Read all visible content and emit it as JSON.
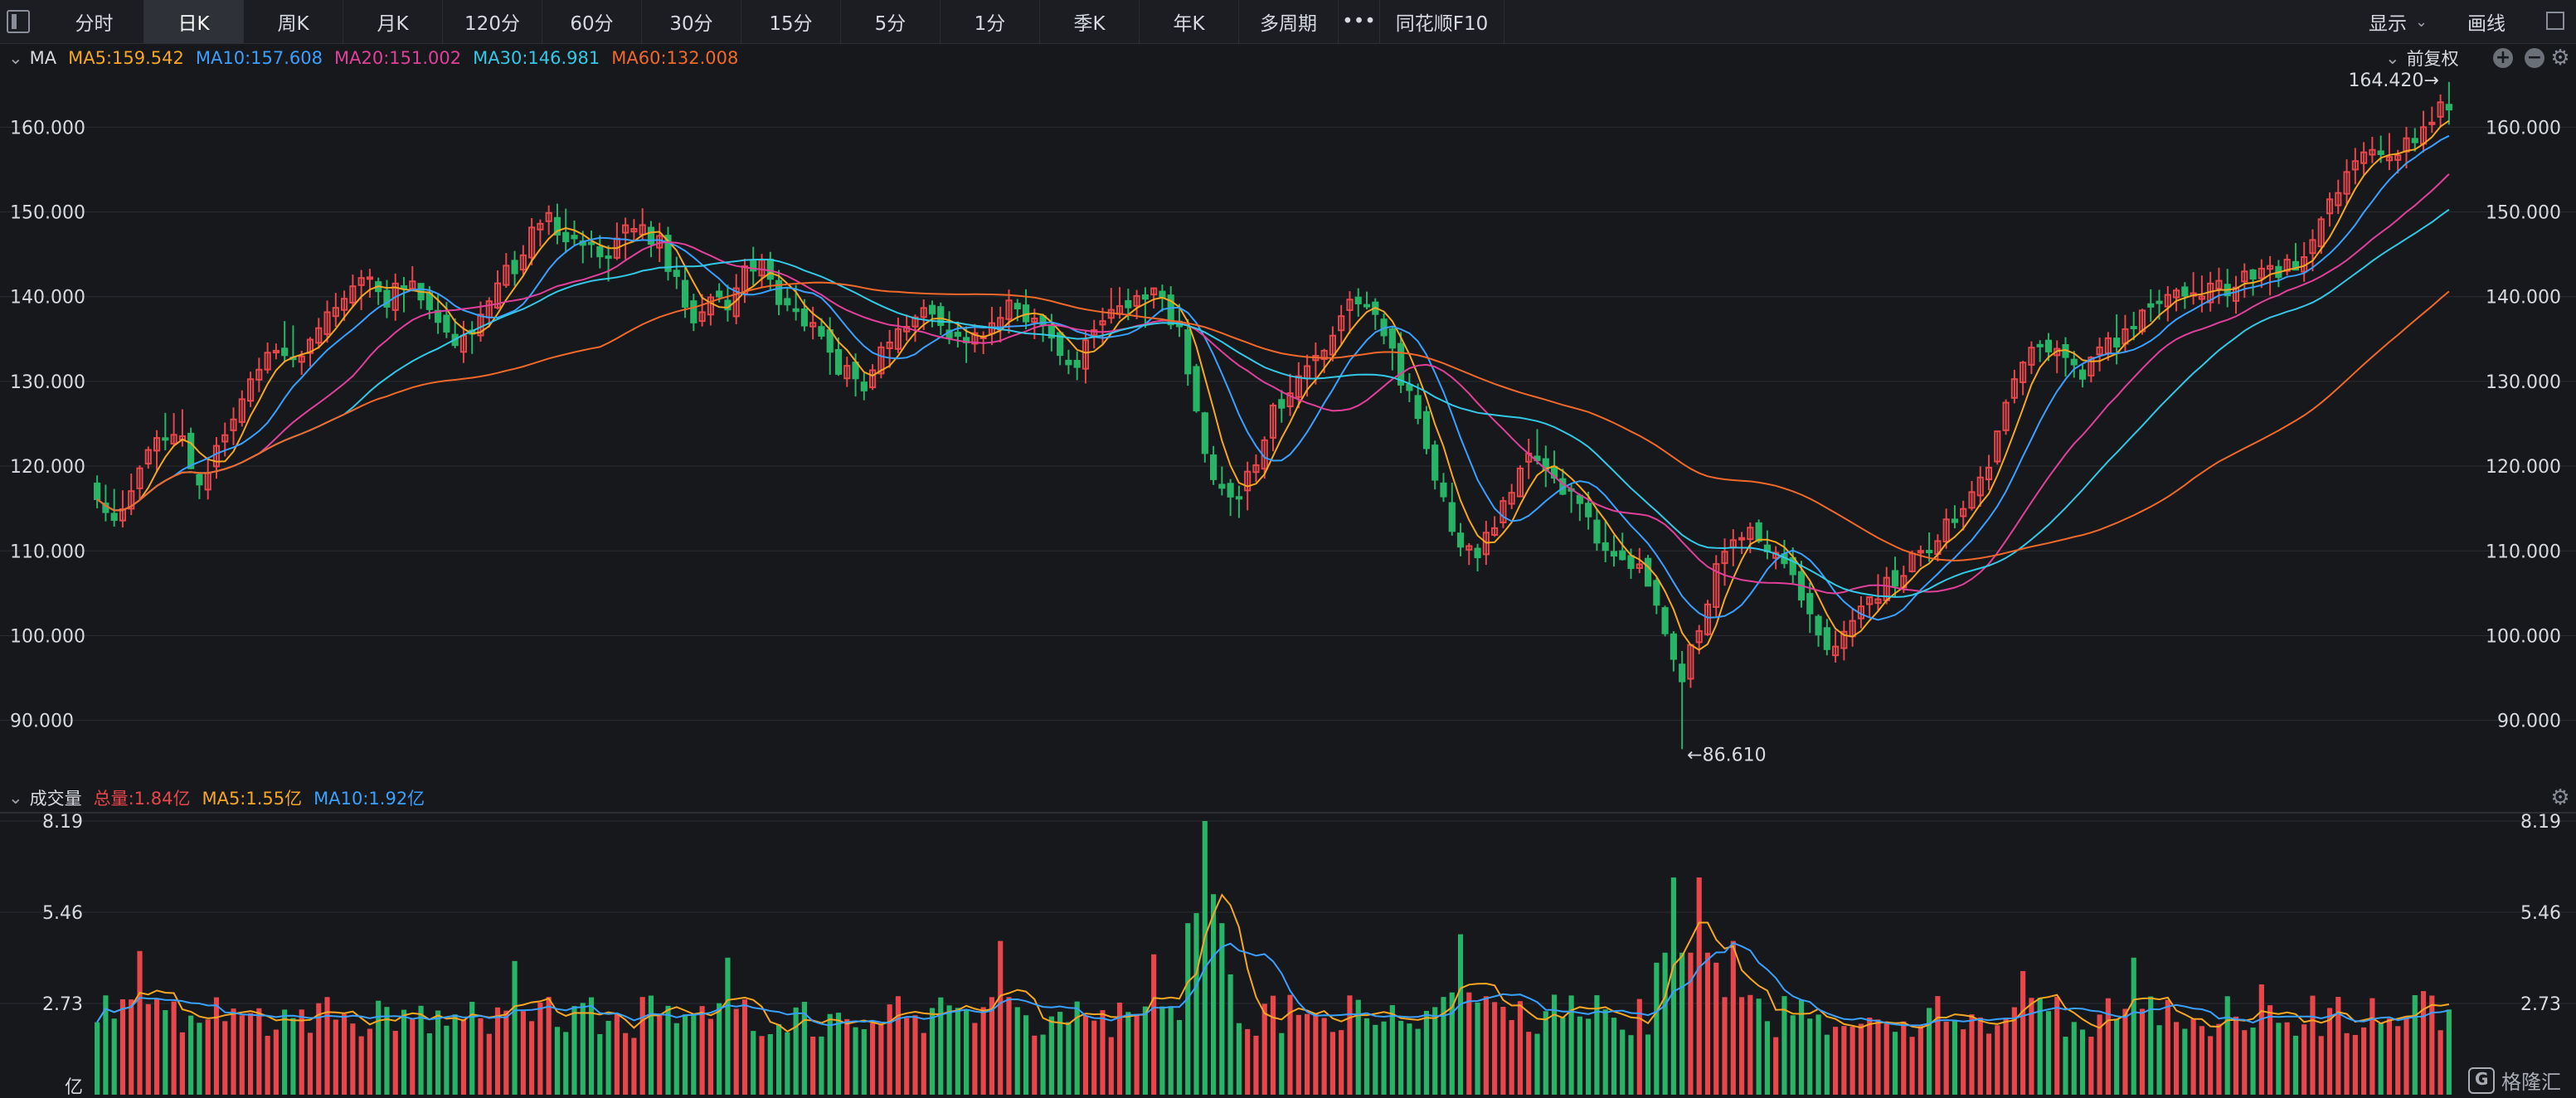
{
  "toolbar": {
    "tabs": [
      "分时",
      "日K",
      "周K",
      "月K",
      "120分",
      "60分",
      "30分",
      "15分",
      "5分",
      "1分",
      "季K",
      "年K",
      "多周期",
      "•••",
      "同花顺F10"
    ],
    "active_tab": "日K",
    "display_label": "显示",
    "draw_label": "画线"
  },
  "price_panel": {
    "indicator_label": "MA",
    "ma_legend": [
      {
        "text": "MA5:159.542",
        "color": "#f5a623"
      },
      {
        "text": "MA10:157.608",
        "color": "#3aa0ff"
      },
      {
        "text": "MA20:151.002",
        "color": "#e0409a"
      },
      {
        "text": "MA30:146.981",
        "color": "#32c8e6"
      },
      {
        "text": "MA60:132.008",
        "color": "#f0692a"
      }
    ],
    "adjust_label": "前复权",
    "high_label": "164.420→",
    "low_label": "←86.610"
  },
  "volume_panel": {
    "indicator_label": "成交量",
    "legend": [
      {
        "text": "总量:1.84亿",
        "color": "#e8464a"
      },
      {
        "text": "MA5:1.55亿",
        "color": "#f5a623"
      },
      {
        "text": "MA10:1.92亿",
        "color": "#3aa0ff"
      }
    ],
    "unit_label": "亿",
    "y_ticks": [
      "8.19",
      "5.46",
      "2.73"
    ]
  },
  "colors": {
    "up": "#e8464a",
    "down": "#27b467",
    "ma5": "#f5a623",
    "ma10": "#3aa0ff",
    "ma20": "#e0409a",
    "ma30": "#32c8e6",
    "ma60": "#f0692a",
    "grid": "#2a2c32",
    "axis_text": "#d6d9df"
  },
  "watermark": "格隆汇",
  "chart_data": {
    "type": "candlestick",
    "ylim": [
      84,
      166
    ],
    "y_ticks": [
      90,
      100,
      110,
      120,
      130,
      140,
      150,
      160
    ],
    "y_tick_labels": [
      "90.000",
      "100.000",
      "110.000",
      "120.000",
      "130.000",
      "140.000",
      "150.000",
      "160.000"
    ],
    "volume_ylim": [
      0,
      8.19
    ],
    "anchor_closes": [
      [
        0,
        117
      ],
      [
        6,
        114
      ],
      [
        12,
        116
      ],
      [
        18,
        120
      ],
      [
        24,
        124
      ],
      [
        30,
        125
      ],
      [
        36,
        118
      ],
      [
        42,
        120
      ],
      [
        50,
        126
      ],
      [
        58,
        132
      ],
      [
        66,
        135
      ],
      [
        72,
        132
      ],
      [
        80,
        136
      ],
      [
        88,
        140
      ],
      [
        96,
        142
      ],
      [
        104,
        140
      ],
      [
        112,
        141
      ],
      [
        118,
        139
      ],
      [
        124,
        136
      ],
      [
        130,
        134
      ],
      [
        138,
        138
      ],
      [
        144,
        142
      ],
      [
        150,
        144
      ],
      [
        156,
        148
      ],
      [
        162,
        149
      ],
      [
        168,
        147
      ],
      [
        174,
        146
      ],
      [
        180,
        145
      ],
      [
        186,
        147
      ],
      [
        192,
        149
      ],
      [
        200,
        146
      ],
      [
        206,
        142
      ],
      [
        212,
        138
      ],
      [
        218,
        140
      ],
      [
        224,
        139
      ],
      [
        230,
        143
      ],
      [
        236,
        144
      ],
      [
        242,
        140
      ],
      [
        248,
        138
      ],
      [
        254,
        136
      ],
      [
        260,
        133
      ],
      [
        266,
        131
      ],
      [
        272,
        130
      ],
      [
        278,
        133
      ],
      [
        284,
        136
      ],
      [
        290,
        138
      ],
      [
        296,
        137
      ],
      [
        302,
        136
      ],
      [
        308,
        134
      ],
      [
        314,
        136
      ],
      [
        320,
        138
      ],
      [
        326,
        139
      ],
      [
        332,
        137
      ],
      [
        340,
        133
      ],
      [
        346,
        131
      ],
      [
        352,
        135
      ],
      [
        358,
        139
      ],
      [
        364,
        140
      ],
      [
        370,
        139
      ],
      [
        374,
        141
      ],
      [
        378,
        139
      ],
      [
        384,
        135
      ],
      [
        390,
        125
      ],
      [
        394,
        120
      ],
      [
        398,
        117
      ],
      [
        404,
        116
      ],
      [
        410,
        121
      ],
      [
        416,
        127
      ],
      [
        422,
        129
      ],
      [
        428,
        131
      ],
      [
        434,
        133
      ],
      [
        440,
        137
      ],
      [
        446,
        140
      ],
      [
        452,
        137
      ],
      [
        458,
        133
      ],
      [
        464,
        128
      ],
      [
        470,
        122
      ],
      [
        476,
        116
      ],
      [
        482,
        111
      ],
      [
        488,
        109
      ],
      [
        494,
        113
      ],
      [
        500,
        118
      ],
      [
        506,
        122
      ],
      [
        512,
        120
      ],
      [
        518,
        117
      ],
      [
        524,
        115
      ],
      [
        530,
        112
      ],
      [
        536,
        110
      ],
      [
        542,
        109
      ],
      [
        548,
        107
      ],
      [
        552,
        103
      ],
      [
        556,
        98
      ],
      [
        560,
        95
      ],
      [
        566,
        101
      ],
      [
        572,
        108
      ],
      [
        578,
        111
      ],
      [
        584,
        112
      ],
      [
        590,
        111
      ],
      [
        596,
        109
      ],
      [
        602,
        104
      ],
      [
        608,
        100
      ],
      [
        614,
        99
      ],
      [
        620,
        102
      ],
      [
        626,
        104
      ],
      [
        632,
        106
      ],
      [
        638,
        108
      ],
      [
        644,
        110
      ],
      [
        650,
        112
      ],
      [
        656,
        114
      ],
      [
        662,
        117
      ],
      [
        668,
        121
      ],
      [
        674,
        127
      ],
      [
        680,
        132
      ],
      [
        686,
        134
      ],
      [
        692,
        133
      ],
      [
        698,
        131
      ],
      [
        704,
        132
      ],
      [
        710,
        134
      ],
      [
        716,
        136
      ],
      [
        722,
        138
      ],
      [
        728,
        139
      ],
      [
        734,
        140
      ],
      [
        740,
        141
      ],
      [
        746,
        141
      ],
      [
        752,
        141
      ],
      [
        758,
        142
      ],
      [
        764,
        143
      ],
      [
        770,
        143
      ],
      [
        776,
        144
      ],
      [
        782,
        146
      ],
      [
        788,
        151
      ],
      [
        794,
        155
      ],
      [
        800,
        157
      ],
      [
        806,
        158
      ],
      [
        812,
        157
      ],
      [
        818,
        159
      ],
      [
        824,
        161
      ],
      [
        830,
        163
      ]
    ],
    "extremes": {
      "high": 164.42,
      "low": 86.61
    },
    "series": [
      {
        "name": "MA5",
        "value": 159.542
      },
      {
        "name": "MA10",
        "value": 157.608
      },
      {
        "name": "MA20",
        "value": 151.002
      },
      {
        "name": "MA30",
        "value": 146.981
      },
      {
        "name": "MA60",
        "value": 132.008
      }
    ],
    "volume_series": [
      {
        "name": "总量",
        "value": 1.84
      },
      {
        "name": "MA5",
        "value": 1.55
      },
      {
        "name": "MA10",
        "value": 1.92
      }
    ],
    "volume_spikes": [
      {
        "day": 15,
        "value": 4.3
      },
      {
        "day": 148,
        "value": 4.0
      },
      {
        "day": 222,
        "value": 4.1
      },
      {
        "day": 318,
        "value": 4.6
      },
      {
        "day": 372,
        "value": 4.2
      },
      {
        "day": 390,
        "value": 8.19
      },
      {
        "day": 394,
        "value": 6.0
      },
      {
        "day": 480,
        "value": 4.8
      },
      {
        "day": 556,
        "value": 6.5
      },
      {
        "day": 566,
        "value": 6.5
      },
      {
        "day": 578,
        "value": 4.6
      },
      {
        "day": 680,
        "value": 3.7
      },
      {
        "day": 718,
        "value": 4.1
      },
      {
        "day": 762,
        "value": 3.3
      },
      {
        "day": 820,
        "value": 3.1
      }
    ]
  }
}
